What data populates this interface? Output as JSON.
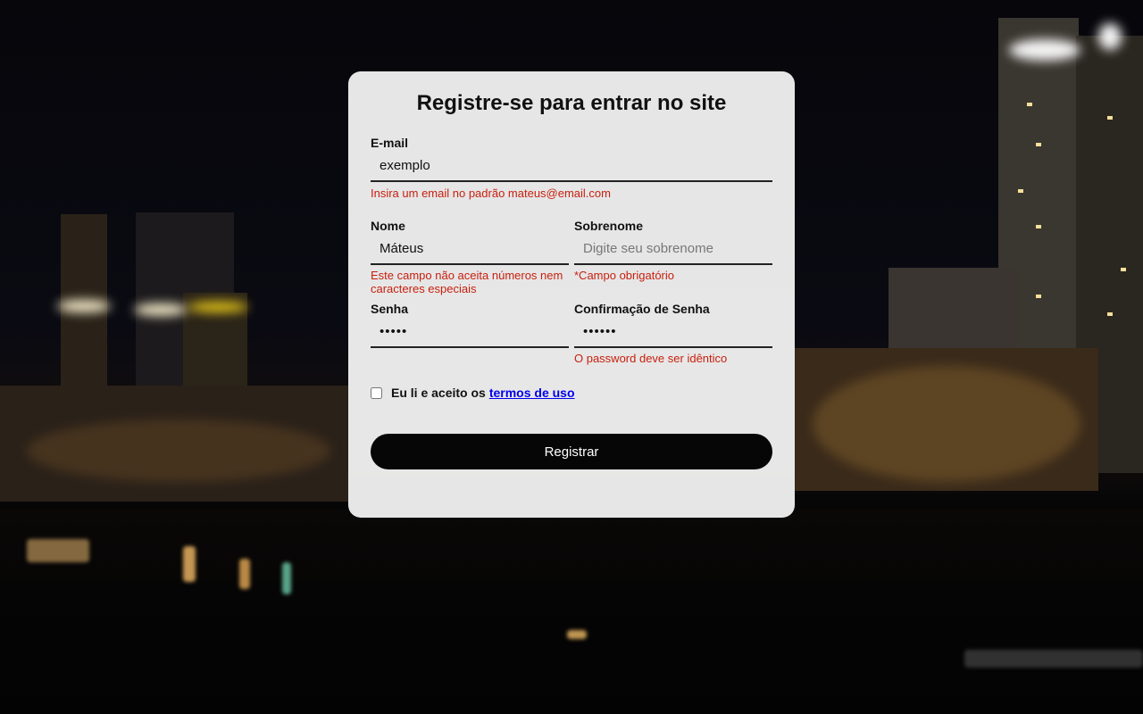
{
  "form": {
    "title": "Registre-se para entrar no site",
    "email": {
      "label": "E-mail",
      "value": "exemplo",
      "error": "Insira um email no padrão mateus@email.com"
    },
    "nome": {
      "label": "Nome",
      "value": "Máteus",
      "error_line1": "Este campo não aceita números nem",
      "error_line2": "caracteres especiais"
    },
    "sobrenome": {
      "label": "Sobrenome",
      "placeholder": "Digite seu sobrenome",
      "error": "*Campo obrigatório"
    },
    "senha": {
      "label": "Senha",
      "value": "•••••"
    },
    "confirmacao": {
      "label": "Confirmação de Senha",
      "value": "••••••",
      "error": "O password deve ser idêntico"
    },
    "terms": {
      "text": "Eu li e aceito os",
      "link": "termos de uso",
      "checked": false
    },
    "submit_label": "Registrar"
  },
  "colors": {
    "error": "#c8200e",
    "button_bg": "#060606",
    "card_bg": "#eeeeee",
    "link": "#0000ee"
  }
}
